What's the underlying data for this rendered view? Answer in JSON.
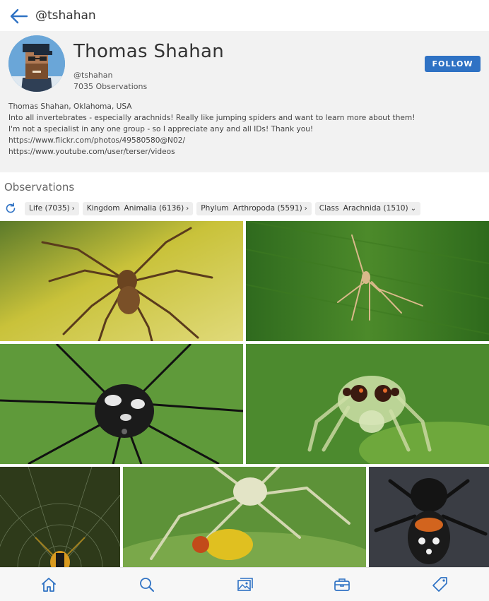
{
  "header": {
    "handle": "@tshahan"
  },
  "profile": {
    "name": "Thomas Shahan",
    "login": "@tshahan",
    "observations": "7035 Observations",
    "follow_label": "FOLLOW",
    "bio_lines": [
      "Thomas Shahan, Oklahoma, USA",
      "Into all invertebrates - especially arachnids! Really like jumping spiders and want to learn more about them!",
      "I'm not a specialist in any one group - so I appreciate any and all IDs! Thank you!",
      "https://www.flickr.com/photos/49580580@N02/",
      "https://www.youtube.com/user/terser/videos"
    ]
  },
  "observations": {
    "title": "Observations",
    "filters": [
      {
        "rank": "",
        "value": "Life (7035)",
        "chevron": "›"
      },
      {
        "rank": "Kingdom",
        "value": "Animalia (6136)",
        "chevron": "›"
      },
      {
        "rank": "Phylum",
        "value": "Arthropoda (5591)",
        "chevron": "›"
      },
      {
        "rank": "Class",
        "value": "Arachnida (1510)",
        "chevron": "⌄"
      }
    ]
  },
  "nav": [
    "home-icon",
    "search-icon",
    "images-icon",
    "briefcase-icon",
    "tag-icon"
  ],
  "colors": {
    "accent": "#2f72c4",
    "icon": "#2f72c4"
  }
}
